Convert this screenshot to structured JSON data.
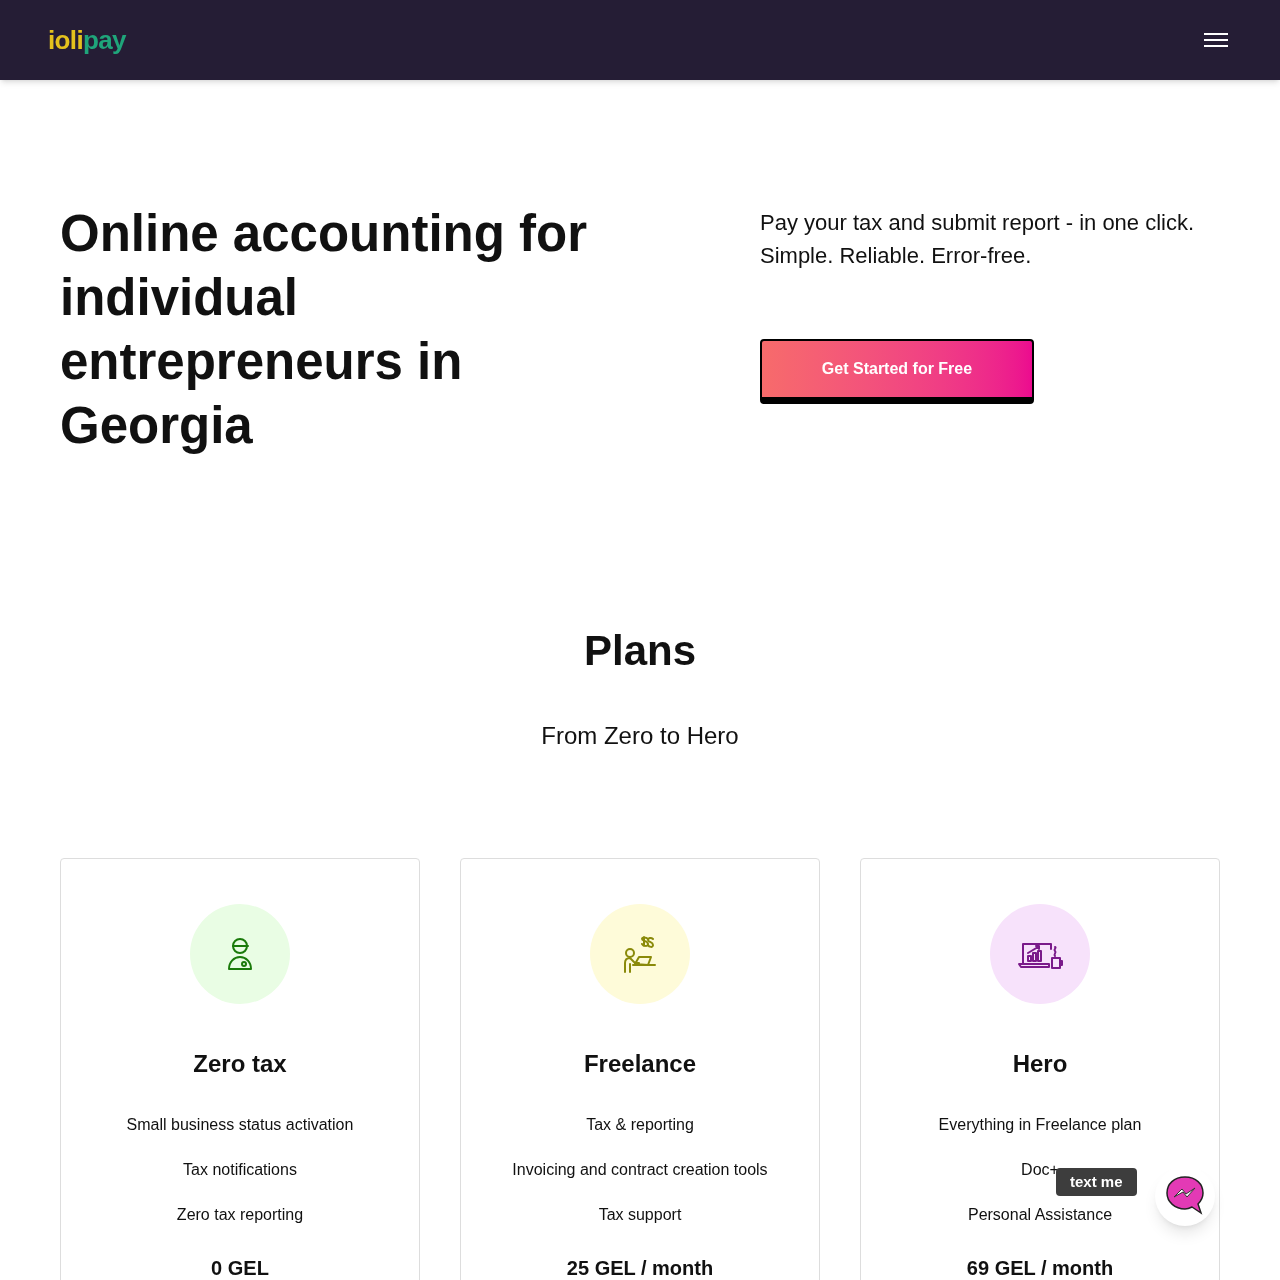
{
  "header": {
    "logo": {
      "part_1": "ioli",
      "part_2": "pay"
    }
  },
  "hero": {
    "title": "Online accounting for individual entrepreneurs in Georgia",
    "lines": [
      "Pay your tax and submit report - in one click.",
      "Simple. Reliable. Error-free."
    ],
    "cta": "Get Started for Free"
  },
  "plans": {
    "title": "Plans",
    "subtitle": "From Zero to Hero",
    "items": [
      {
        "kind": "worker",
        "color": "#e9fde4",
        "name": "Zero tax",
        "features": [
          "Small business status activation",
          "Tax notifications",
          "Zero tax reporting"
        ],
        "price": "0 GEL"
      },
      {
        "kind": "freelancer",
        "color": "#fefbd9",
        "name": "Freelance",
        "features": [
          "Tax & reporting",
          "Invoicing and contract creation tools",
          "Tax support"
        ],
        "price": "25 GEL / month"
      },
      {
        "kind": "laptop",
        "color": "#f7e2fb",
        "name": "Hero",
        "features": [
          "Everything in Freelance plan",
          "Doc+",
          "Personal Assistance"
        ],
        "price": "69 GEL / month"
      }
    ]
  },
  "chat": {
    "tooltip": "text me"
  }
}
